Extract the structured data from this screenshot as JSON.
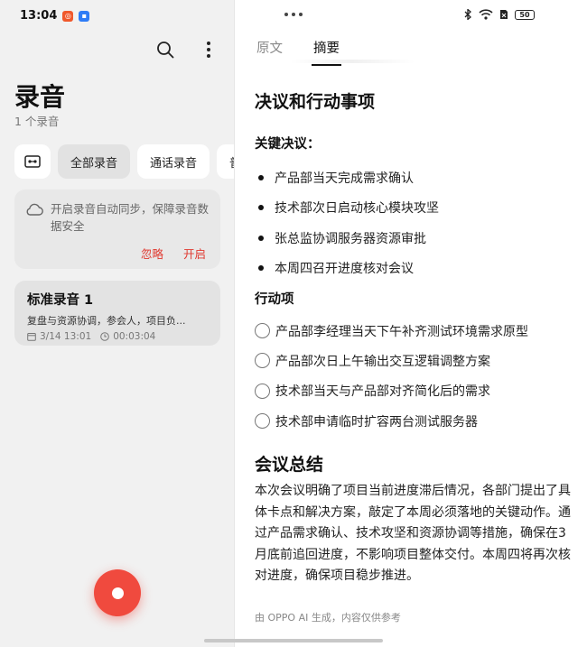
{
  "status_bar": {
    "time": "13:04",
    "battery": "50"
  },
  "left": {
    "title": "录音",
    "count": "1 个录音",
    "filters": [
      "全部录音",
      "通话录音",
      "普"
    ],
    "sync_card": {
      "message": "开启录音自动同步，保障录音数据安全",
      "ignore_label": "忽略",
      "enable_label": "开启"
    },
    "recording": {
      "title": "标准录音 1",
      "description": "复盘与资源协调，参会人，项目负...",
      "date": "3/14 13:01",
      "duration": "00:03:04"
    }
  },
  "right": {
    "tabs": [
      "原文",
      "摘要"
    ],
    "active_tab": "摘要",
    "section_title": "决议和行动事项",
    "decisions_heading": "关键决议：",
    "decisions": [
      "产品部当天完成需求确认",
      "技术部次日启动核心模块攻坚",
      "张总监协调服务器资源审批",
      "本周四召开进度核对会议"
    ],
    "actions_heading": "行动项",
    "actions": [
      "产品部李经理当天下午补齐测试环境需求原型",
      "产品部次日上午输出交互逻辑调整方案",
      "技术部当天与产品部对齐简化后的需求",
      "技术部申请临时扩容两台测试服务器"
    ],
    "summary_heading": "会议总结",
    "summary_text": "本次会议明确了项目当前进度滞后情况，各部门提出了具体卡点和解决方案，敲定了本周必须落地的关键动作。通过产品需求确认、技术攻坚和资源协调等措施，确保在3月底前追回进度，不影响项目整体交付。本周四将再次核对进度，确保项目稳步推进。",
    "footer": "由 OPPO AI 生成，内容仅供参考"
  },
  "colors": {
    "accent_red": "#e0382f",
    "record_button": "#f04a3e"
  }
}
